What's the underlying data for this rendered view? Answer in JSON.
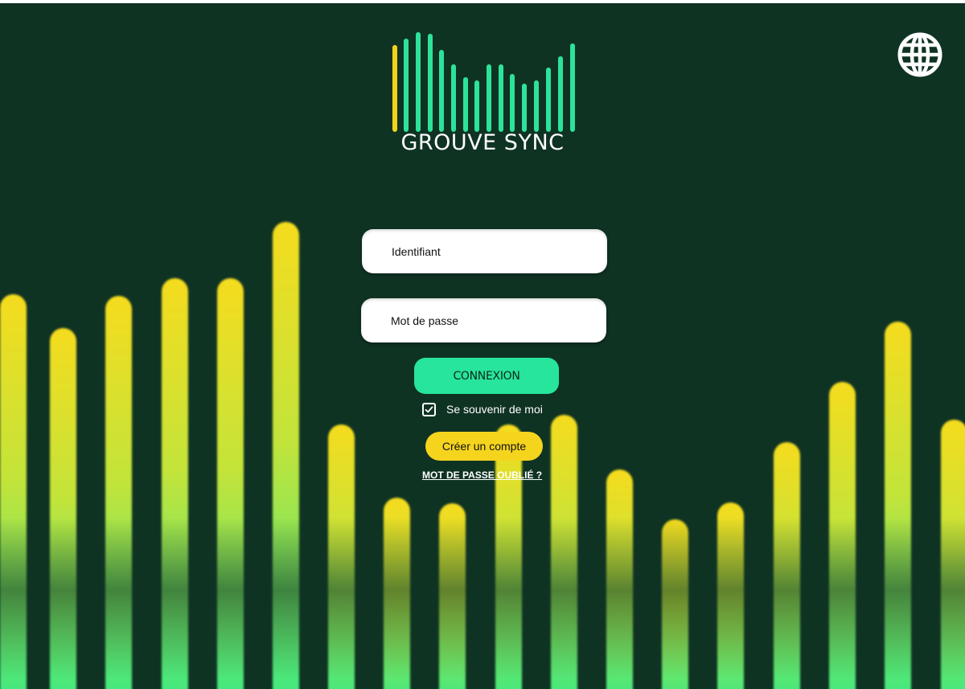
{
  "app": {
    "name": "GROUVE SYNC"
  },
  "colors": {
    "background": "#0f3323",
    "accent_green": "#27e59a",
    "accent_yellow": "#f5d41e",
    "field_background": "#ffffff"
  },
  "header": {
    "language_icon": "globe-icon"
  },
  "login_form": {
    "username_placeholder": "Identifiant",
    "password_placeholder": "Mot de passe",
    "submit_label": "CONNEXION",
    "remember_me": {
      "label": "Se souvenir de moi",
      "checked": true
    },
    "create_account_label": "Créer un compte",
    "forgot_password_label": "MOT DE PASSE OUBLIÉ ?"
  }
}
